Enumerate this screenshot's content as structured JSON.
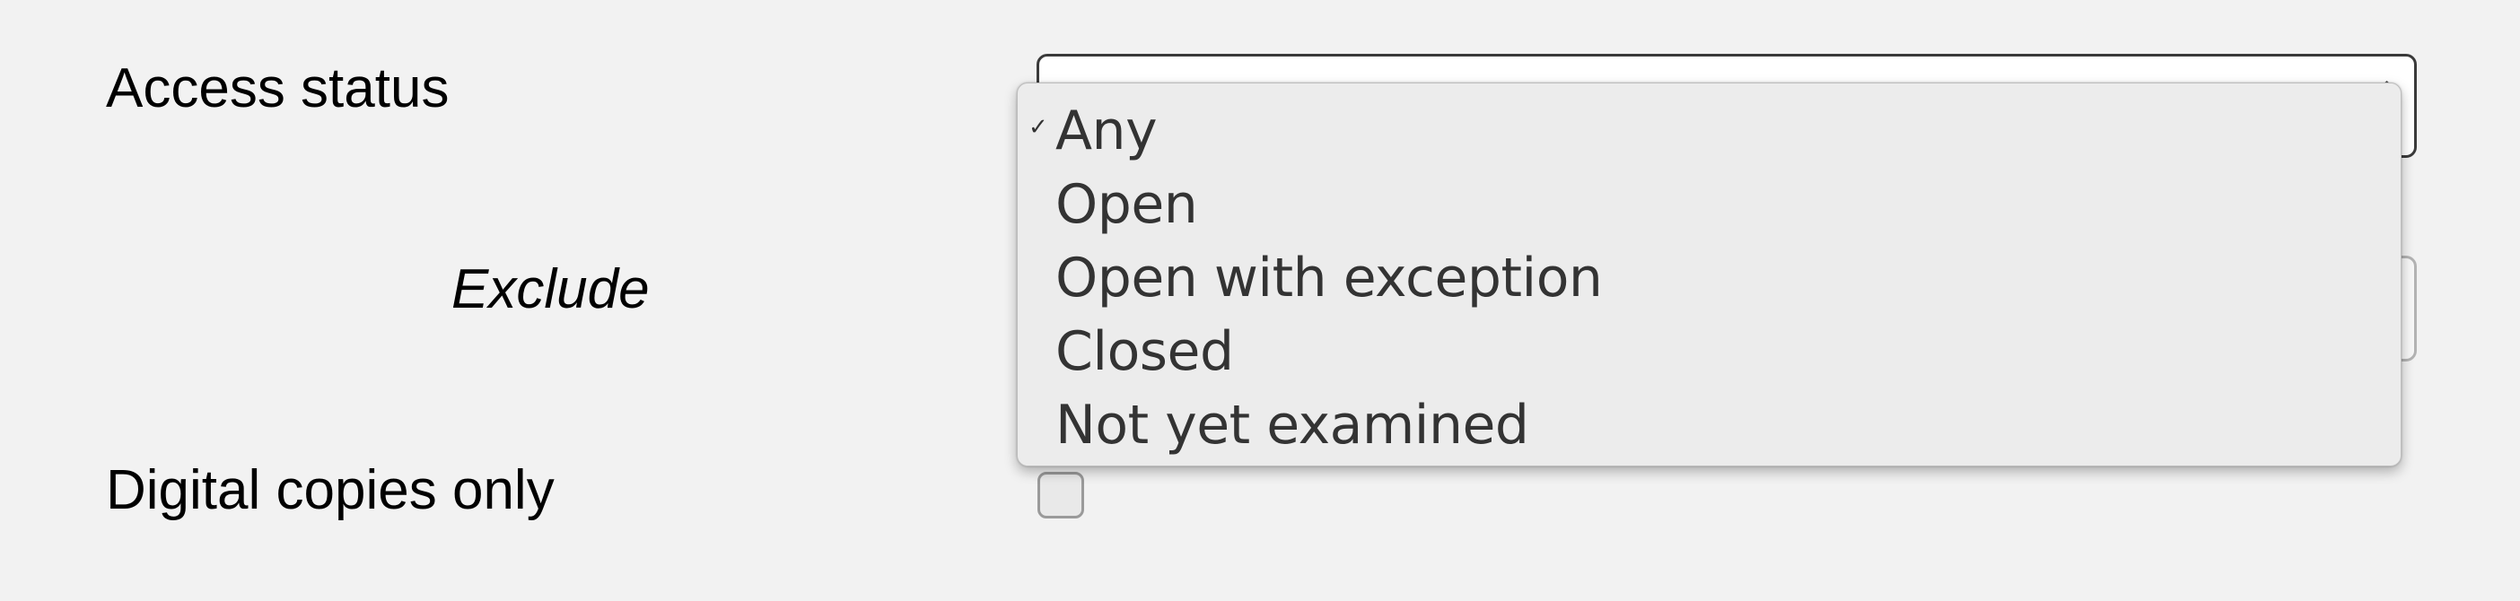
{
  "form": {
    "access_status_label": "Access status",
    "exclude_label": "Exclude",
    "digital_copies_label": "Digital copies only",
    "digital_copies_checked": false
  },
  "access_status_select": {
    "selected_value": "Any",
    "options": [
      {
        "label": "Any",
        "selected": true
      },
      {
        "label": "Open",
        "selected": false
      },
      {
        "label": "Open with exception",
        "selected": false
      },
      {
        "label": "Closed",
        "selected": false
      },
      {
        "label": "Not yet examined",
        "selected": false
      }
    ],
    "check_mark": "✓"
  },
  "icons": {
    "select_arrow": "chevron-up-down-icon",
    "check": "checkmark-icon"
  }
}
